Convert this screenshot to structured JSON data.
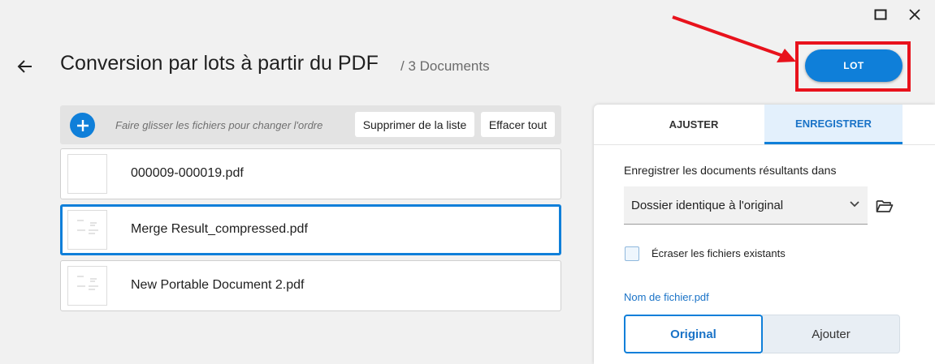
{
  "window": {
    "maximize_icon": "maximize-icon",
    "close_icon": "close-icon"
  },
  "header": {
    "back_icon": "arrow-left-icon",
    "title": "Conversion par lots à partir du PDF",
    "doc_count": "/ 3 Documents",
    "lot_button": "LOT"
  },
  "file_list": {
    "add_icon": "plus-icon",
    "drag_hint": "Faire glisser les fichiers pour changer l'ordre",
    "delete_list_label": "Supprimer de la liste",
    "clear_all_label": "Effacer tout",
    "files": [
      {
        "name": "000009-000019.pdf",
        "selected": false
      },
      {
        "name": "Merge Result_compressed.pdf",
        "selected": true
      },
      {
        "name": "New Portable Document 2.pdf",
        "selected": false
      }
    ]
  },
  "panel": {
    "tabs": [
      {
        "label": "AJUSTER",
        "active": false
      },
      {
        "label": "ENREGISTRER",
        "active": true
      }
    ],
    "save_label": "Enregistrer les documents résultants dans",
    "folder_option": "Dossier identique à l'original",
    "folder_icon": "folder-open-icon",
    "overwrite_label": "Écraser les fichiers existants",
    "overwrite_checked": false,
    "filename_link": "Nom de fichier.pdf",
    "filename_modes": [
      "Original",
      "Ajouter"
    ],
    "filename_mode_selected": "Original"
  },
  "colors": {
    "accent": "#0f7fd9",
    "annotation": "#e8121c"
  }
}
